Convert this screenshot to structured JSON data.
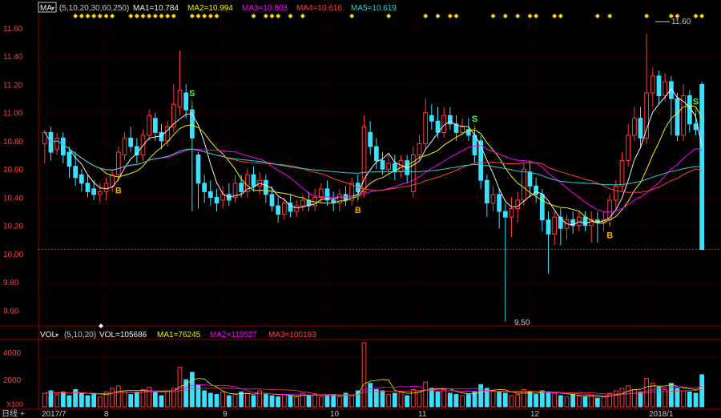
{
  "main_legend": {
    "ma_label": "MA",
    "params": "(5,10,20,30,60,250)",
    "items": [
      {
        "text": "MA1=10.784",
        "color": "#f0f0f0"
      },
      {
        "text": "MA2=10.994",
        "color": "#f0f000"
      },
      {
        "text": "MA3=10.803",
        "color": "#ff00ff"
      },
      {
        "text": "MA4=10.616",
        "color": "#ff4040"
      },
      {
        "text": "MA5=10.619",
        "color": "#30d0d0"
      }
    ]
  },
  "price_axis": {
    "ticks": [
      "11.60",
      "11.40",
      "11.20",
      "11.00",
      "10.80",
      "10.60",
      "10.40",
      "10.20",
      "10.00",
      "9.80",
      "9.60"
    ]
  },
  "annotations": {
    "high": "11.60",
    "low": "9.50"
  },
  "signals": {
    "buy": "B",
    "sell": "S"
  },
  "volume_legend": {
    "vol_label": "VOL",
    "params": "(5,10,20)",
    "items": [
      {
        "text": "VOL=105686",
        "color": "#f0f0f0"
      },
      {
        "text": "MA1=76245",
        "color": "#f0f000"
      },
      {
        "text": "MA2=119527",
        "color": "#ff00ff"
      },
      {
        "text": "MA3=100183",
        "color": "#ff4040"
      }
    ]
  },
  "volume_axis": {
    "ticks": [
      "4000",
      "2000"
    ],
    "unit": "X100"
  },
  "date_axis": {
    "labels": [
      "2017/7",
      "8",
      "9",
      "10",
      "11",
      "12",
      "2018/1"
    ]
  },
  "period_label": "日线",
  "colors": {
    "up": "#ff3b3b",
    "down": "#3ce0ff",
    "grid": "#8b0000",
    "buy": "#ffa500",
    "sell": "#40ff40",
    "marker": "#ffd200"
  },
  "chart_data": {
    "type": "candlestick",
    "ylim": [
      9.5,
      11.6
    ],
    "candles": [
      {
        "o": 10.78,
        "c": 10.86,
        "h": 10.88,
        "l": 10.64
      },
      {
        "o": 10.86,
        "c": 10.72,
        "h": 10.9,
        "l": 10.66
      },
      {
        "o": 10.74,
        "c": 10.82,
        "h": 10.86,
        "l": 10.7
      },
      {
        "o": 10.82,
        "c": 10.7,
        "h": 10.86,
        "l": 10.64
      },
      {
        "o": 10.72,
        "c": 10.62,
        "h": 10.76,
        "l": 10.54
      },
      {
        "o": 10.62,
        "c": 10.54,
        "h": 10.72,
        "l": 10.48
      },
      {
        "o": 10.56,
        "c": 10.5,
        "h": 10.6,
        "l": 10.44
      },
      {
        "o": 10.5,
        "c": 10.44,
        "h": 10.56,
        "l": 10.4
      },
      {
        "o": 10.46,
        "c": 10.42,
        "h": 10.52,
        "l": 10.38
      },
      {
        "o": 10.42,
        "c": 10.44,
        "h": 10.5,
        "l": 10.36
      },
      {
        "o": 10.44,
        "c": 10.5,
        "h": 10.54,
        "l": 10.38
      },
      {
        "o": 10.48,
        "c": 10.56,
        "h": 10.6,
        "l": 10.44
      },
      {
        "o": 10.56,
        "c": 10.72,
        "h": 10.76,
        "l": 10.52
      },
      {
        "o": 10.7,
        "c": 10.82,
        "h": 10.86,
        "l": 10.66
      },
      {
        "o": 10.82,
        "c": 10.76,
        "h": 10.9,
        "l": 10.72
      },
      {
        "o": 10.76,
        "c": 10.7,
        "h": 10.82,
        "l": 10.64
      },
      {
        "o": 10.7,
        "c": 10.84,
        "h": 10.88,
        "l": 10.66
      },
      {
        "o": 10.84,
        "c": 10.98,
        "h": 11.02,
        "l": 10.8
      },
      {
        "o": 10.96,
        "c": 10.86,
        "h": 11.0,
        "l": 10.8
      },
      {
        "o": 10.86,
        "c": 10.8,
        "h": 10.92,
        "l": 10.74
      },
      {
        "o": 10.8,
        "c": 10.9,
        "h": 10.94,
        "l": 10.76
      },
      {
        "o": 10.9,
        "c": 11.06,
        "h": 11.2,
        "l": 10.86
      },
      {
        "o": 11.04,
        "c": 11.16,
        "h": 11.44,
        "l": 10.98
      },
      {
        "o": 11.14,
        "c": 11.02,
        "h": 11.2,
        "l": 10.96
      },
      {
        "o": 11.02,
        "c": 10.82,
        "h": 11.06,
        "l": 10.3
      },
      {
        "o": 10.7,
        "c": 10.5,
        "h": 10.72,
        "l": 10.32
      },
      {
        "o": 10.5,
        "c": 10.44,
        "h": 10.56,
        "l": 10.36
      },
      {
        "o": 10.44,
        "c": 10.4,
        "h": 10.52,
        "l": 10.34
      },
      {
        "o": 10.4,
        "c": 10.36,
        "h": 10.46,
        "l": 10.3
      },
      {
        "o": 10.38,
        "c": 10.42,
        "h": 10.48,
        "l": 10.32
      },
      {
        "o": 10.42,
        "c": 10.38,
        "h": 10.5,
        "l": 10.34
      },
      {
        "o": 10.4,
        "c": 10.5,
        "h": 10.56,
        "l": 10.36
      },
      {
        "o": 10.5,
        "c": 10.44,
        "h": 10.56,
        "l": 10.4
      },
      {
        "o": 10.44,
        "c": 10.56,
        "h": 10.6,
        "l": 10.4
      },
      {
        "o": 10.56,
        "c": 10.48,
        "h": 10.62,
        "l": 10.44
      },
      {
        "o": 10.48,
        "c": 10.52,
        "h": 10.58,
        "l": 10.42
      },
      {
        "o": 10.52,
        "c": 10.42,
        "h": 10.56,
        "l": 10.36
      },
      {
        "o": 10.42,
        "c": 10.34,
        "h": 10.48,
        "l": 10.3
      },
      {
        "o": 10.34,
        "c": 10.28,
        "h": 10.4,
        "l": 10.22
      },
      {
        "o": 10.28,
        "c": 10.36,
        "h": 10.4,
        "l": 10.24
      },
      {
        "o": 10.36,
        "c": 10.3,
        "h": 10.42,
        "l": 10.26
      },
      {
        "o": 10.3,
        "c": 10.34,
        "h": 10.38,
        "l": 10.26
      },
      {
        "o": 10.34,
        "c": 10.38,
        "h": 10.42,
        "l": 10.3
      },
      {
        "o": 10.38,
        "c": 10.34,
        "h": 10.44,
        "l": 10.3
      },
      {
        "o": 10.34,
        "c": 10.4,
        "h": 10.46,
        "l": 10.3
      },
      {
        "o": 10.4,
        "c": 10.46,
        "h": 10.5,
        "l": 10.36
      },
      {
        "o": 10.46,
        "c": 10.38,
        "h": 10.52,
        "l": 10.34
      },
      {
        "o": 10.38,
        "c": 10.36,
        "h": 10.44,
        "l": 10.3
      },
      {
        "o": 10.36,
        "c": 10.42,
        "h": 10.46,
        "l": 10.3
      },
      {
        "o": 10.42,
        "c": 10.38,
        "h": 10.48,
        "l": 10.34
      },
      {
        "o": 10.38,
        "c": 10.5,
        "h": 10.54,
        "l": 10.34
      },
      {
        "o": 10.5,
        "c": 10.44,
        "h": 10.56,
        "l": 10.38
      },
      {
        "o": 10.44,
        "c": 10.9,
        "h": 10.98,
        "l": 10.4
      },
      {
        "o": 10.86,
        "c": 10.76,
        "h": 10.94,
        "l": 10.7
      },
      {
        "o": 10.76,
        "c": 10.66,
        "h": 10.82,
        "l": 10.6
      },
      {
        "o": 10.66,
        "c": 10.6,
        "h": 10.72,
        "l": 10.56
      },
      {
        "o": 10.6,
        "c": 10.64,
        "h": 10.7,
        "l": 10.56
      },
      {
        "o": 10.64,
        "c": 10.58,
        "h": 10.7,
        "l": 10.52
      },
      {
        "o": 10.58,
        "c": 10.66,
        "h": 10.7,
        "l": 10.54
      },
      {
        "o": 10.66,
        "c": 10.56,
        "h": 10.7,
        "l": 10.5
      },
      {
        "o": 10.44,
        "c": 10.7,
        "h": 10.76,
        "l": 10.4
      },
      {
        "o": 10.7,
        "c": 10.78,
        "h": 10.84,
        "l": 10.66
      },
      {
        "o": 10.78,
        "c": 11.0,
        "h": 11.1,
        "l": 10.74
      },
      {
        "o": 10.98,
        "c": 10.94,
        "h": 11.06,
        "l": 10.88
      },
      {
        "o": 10.94,
        "c": 10.86,
        "h": 11.04,
        "l": 10.82
      },
      {
        "o": 10.86,
        "c": 10.98,
        "h": 11.04,
        "l": 10.82
      },
      {
        "o": 10.98,
        "c": 10.92,
        "h": 11.04,
        "l": 10.88
      },
      {
        "o": 10.92,
        "c": 10.86,
        "h": 10.98,
        "l": 10.8
      },
      {
        "o": 10.86,
        "c": 10.9,
        "h": 10.96,
        "l": 10.84
      },
      {
        "o": 10.88,
        "c": 10.84,
        "h": 10.96,
        "l": 10.8
      },
      {
        "o": 10.84,
        "c": 10.7,
        "h": 10.88,
        "l": 10.64
      },
      {
        "o": 10.8,
        "c": 10.52,
        "h": 10.84,
        "l": 10.46
      },
      {
        "o": 10.52,
        "c": 10.36,
        "h": 10.56,
        "l": 10.26
      },
      {
        "o": 10.36,
        "c": 10.42,
        "h": 10.48,
        "l": 10.3
      },
      {
        "o": 10.42,
        "c": 10.3,
        "h": 10.46,
        "l": 10.18
      },
      {
        "o": 10.3,
        "c": 10.26,
        "h": 10.36,
        "l": 9.52
      },
      {
        "o": 10.26,
        "c": 10.32,
        "h": 10.4,
        "l": 10.12
      },
      {
        "o": 10.32,
        "c": 10.38,
        "h": 10.44,
        "l": 10.22
      },
      {
        "o": 10.38,
        "c": 10.6,
        "h": 10.64,
        "l": 10.34
      },
      {
        "o": 10.58,
        "c": 10.48,
        "h": 10.66,
        "l": 10.4
      },
      {
        "o": 10.48,
        "c": 10.42,
        "h": 10.54,
        "l": 10.36
      },
      {
        "o": 10.42,
        "c": 10.24,
        "h": 10.46,
        "l": 10.16
      },
      {
        "o": 10.24,
        "c": 10.14,
        "h": 10.3,
        "l": 9.86
      },
      {
        "o": 10.14,
        "c": 10.26,
        "h": 10.3,
        "l": 10.06
      },
      {
        "o": 10.26,
        "c": 10.18,
        "h": 10.32,
        "l": 10.06
      },
      {
        "o": 10.18,
        "c": 10.24,
        "h": 10.28,
        "l": 10.1
      },
      {
        "o": 10.24,
        "c": 10.2,
        "h": 10.3,
        "l": 10.14
      },
      {
        "o": 10.2,
        "c": 10.26,
        "h": 10.3,
        "l": 10.16
      },
      {
        "o": 10.26,
        "c": 10.2,
        "h": 10.3,
        "l": 10.16
      },
      {
        "o": 10.2,
        "c": 10.24,
        "h": 10.3,
        "l": 10.08
      },
      {
        "o": 10.24,
        "c": 10.22,
        "h": 10.3,
        "l": 10.08
      },
      {
        "o": 10.22,
        "c": 10.24,
        "h": 10.3,
        "l": 10.16
      },
      {
        "o": 10.24,
        "c": 10.38,
        "h": 10.42,
        "l": 10.2
      },
      {
        "o": 10.38,
        "c": 10.48,
        "h": 10.52,
        "l": 10.32
      },
      {
        "o": 10.48,
        "c": 10.66,
        "h": 10.72,
        "l": 10.44
      },
      {
        "o": 10.66,
        "c": 10.84,
        "h": 10.92,
        "l": 10.62
      },
      {
        "o": 10.84,
        "c": 10.96,
        "h": 11.04,
        "l": 10.8
      },
      {
        "o": 10.96,
        "c": 10.82,
        "h": 11.04,
        "l": 10.76
      },
      {
        "o": 10.82,
        "c": 11.14,
        "h": 11.56,
        "l": 10.78
      },
      {
        "o": 11.14,
        "c": 11.26,
        "h": 11.32,
        "l": 11.04
      },
      {
        "o": 11.26,
        "c": 11.12,
        "h": 11.3,
        "l": 11.06
      },
      {
        "o": 11.12,
        "c": 11.22,
        "h": 11.28,
        "l": 11.08
      },
      {
        "o": 11.22,
        "c": 11.1,
        "h": 11.26,
        "l": 10.84
      },
      {
        "o": 11.1,
        "c": 10.84,
        "h": 11.14,
        "l": 10.8
      },
      {
        "o": 10.84,
        "c": 11.12,
        "h": 11.2,
        "l": 10.8
      },
      {
        "o": 11.12,
        "c": 10.92,
        "h": 11.16,
        "l": 10.86
      },
      {
        "o": 10.92,
        "c": 10.88,
        "h": 11.0,
        "l": 10.84
      },
      {
        "o": 11.2,
        "c": 10.03,
        "h": 11.22,
        "l": 10.03
      }
    ],
    "ma_series": [
      {
        "name": "MA1",
        "period": 5,
        "color": "#f0f0f0"
      },
      {
        "name": "MA2",
        "period": 10,
        "color": "#f0f000"
      },
      {
        "name": "MA3",
        "period": 20,
        "color": "#ff00ff"
      },
      {
        "name": "MA4",
        "period": 30,
        "color": "#ff4040"
      },
      {
        "name": "MA5",
        "period": 60,
        "color": "#30d0d0"
      }
    ],
    "buy_signals": [
      12,
      51,
      92
    ],
    "sell_signals": [
      24,
      70,
      106
    ],
    "volume_ylim": [
      0,
      5200
    ],
    "volume": [
      1100,
      1300,
      1000,
      1200,
      900,
      1400,
      1100,
      900,
      1000,
      800,
      1200,
      1500,
      1700,
      1300,
      1000,
      1200,
      1400,
      1600,
      1200,
      900,
      1300,
      1500,
      3200,
      2200,
      2800,
      1800,
      1300,
      1100,
      1000,
      1200,
      900,
      1000,
      1200,
      1100,
      900,
      1300,
      1000,
      900,
      800,
      1000,
      900,
      800,
      1100,
      900,
      1000,
      800,
      900,
      1000,
      800,
      1100,
      900,
      1300,
      5200,
      1900,
      1400,
      1300,
      1000,
      1100,
      1200,
      900,
      1400,
      1300,
      2000,
      1500,
      1200,
      1400,
      1100,
      1000,
      900,
      1000,
      1200,
      1800,
      1500,
      1300,
      1200,
      1100,
      900,
      1000,
      1400,
      1200,
      1000,
      1300,
      1200,
      1100,
      900,
      800,
      1000,
      900,
      800,
      900,
      700,
      800,
      1100,
      1300,
      1500,
      1700,
      1400,
      1200,
      2300,
      1900,
      1600,
      1400,
      1900,
      1500,
      1300,
      1200,
      1100,
      2600
    ]
  }
}
